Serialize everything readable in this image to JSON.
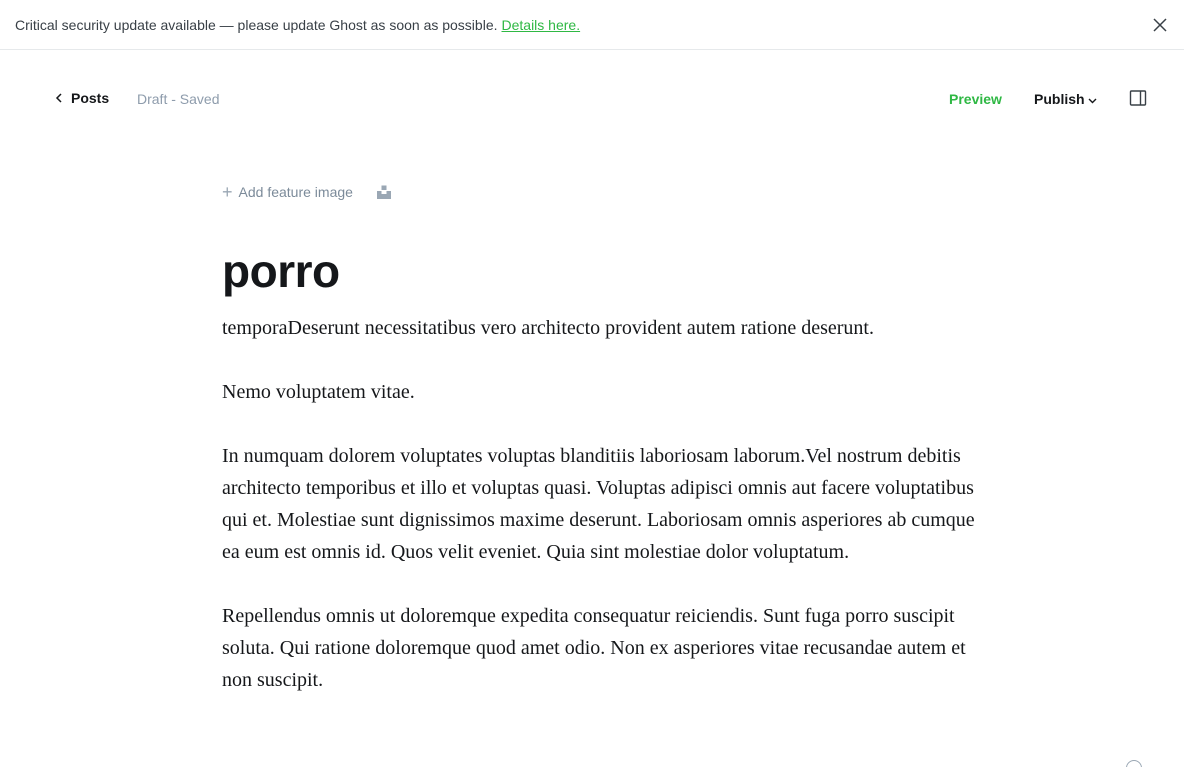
{
  "banner": {
    "message": "Critical security update available — please update Ghost as soon as possible.",
    "link_label": "Details here."
  },
  "header": {
    "back_label": "Posts",
    "status": "Draft - Saved",
    "preview_label": "Preview",
    "publish_label": "Publish"
  },
  "editor": {
    "add_feature_image": "Add feature image",
    "title": "porro",
    "paragraphs": [
      "temporaDeserunt necessitatibus vero architecto provident autem ratione deserunt.",
      "Nemo voluptatem vitae.",
      "In numquam dolorem voluptates voluptas blanditiis laboriosam laborum.Vel nostrum debitis architecto temporibus et illo et voluptas quasi. Voluptas adipisci omnis aut facere voluptatibus qui et. Molestiae sunt dignissimos maxime deserunt. Laboriosam omnis asperiores ab cumque ea eum est omnis id. Quos velit eveniet. Quia sint molestiae dolor voluptatum.",
      "Repellendus omnis ut doloremque expedita consequatur reiciendis. Sunt fuga porro suscipit soluta. Qui ratione doloremque quod amet odio. Non ex asperiores vitae recusandae autem et non suscipit."
    ]
  },
  "icons": {
    "close": "close-icon",
    "back": "chevron-left-icon",
    "publish_caret": "chevron-down-icon",
    "sidebar": "sidebar-toggle-icon",
    "unsplash": "unsplash-icon",
    "help": "help-icon"
  }
}
